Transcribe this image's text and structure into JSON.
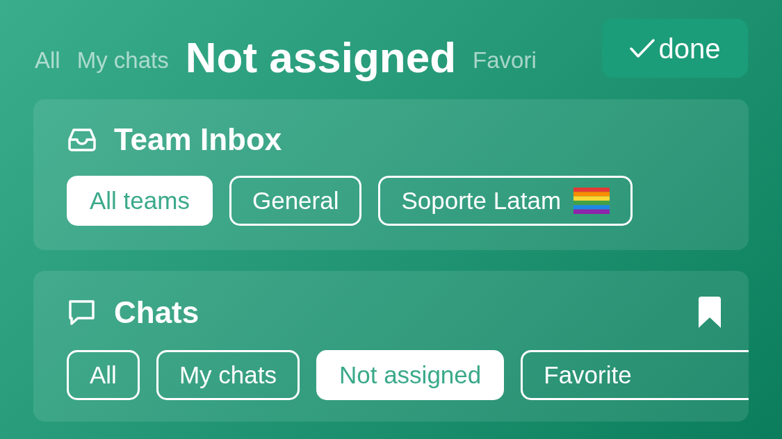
{
  "header": {
    "tabs": [
      {
        "label": "All",
        "selected": false
      },
      {
        "label": "My chats",
        "selected": false
      },
      {
        "label": "Not assigned",
        "selected": true
      },
      {
        "label": "Favori",
        "selected": false
      }
    ],
    "done_button": {
      "label": "done"
    }
  },
  "sections": [
    {
      "kind": "inbox",
      "title": "Team Inbox",
      "bookmarked": false,
      "chips": [
        {
          "label": "All teams",
          "selected": true,
          "has_flag": false,
          "cut": false
        },
        {
          "label": "General",
          "selected": false,
          "has_flag": false,
          "cut": false
        },
        {
          "label": "Soporte Latam",
          "selected": false,
          "has_flag": true,
          "cut": false
        }
      ]
    },
    {
      "kind": "chats",
      "title": "Chats",
      "bookmarked": true,
      "chips": [
        {
          "label": "All",
          "selected": false,
          "has_flag": false,
          "cut": false
        },
        {
          "label": "My chats",
          "selected": false,
          "has_flag": false,
          "cut": false
        },
        {
          "label": "Not assigned",
          "selected": true,
          "has_flag": false,
          "cut": false
        },
        {
          "label": "Favorite",
          "selected": false,
          "has_flag": false,
          "cut": true
        }
      ]
    }
  ]
}
